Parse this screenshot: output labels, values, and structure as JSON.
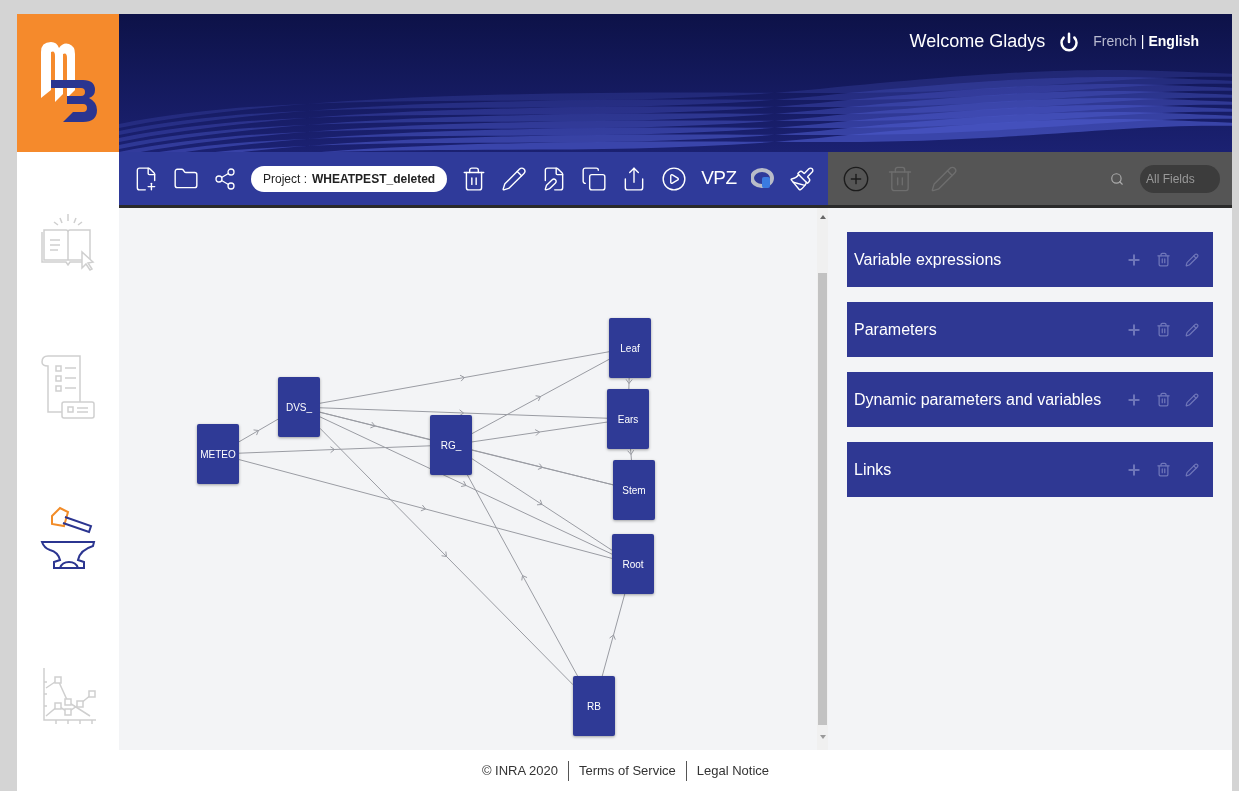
{
  "header": {
    "welcome": "Welcome Gladys",
    "languages": [
      {
        "label": "French",
        "selected": false
      },
      {
        "label": "English",
        "selected": true
      }
    ],
    "separator": "|"
  },
  "sidebar": {
    "items": [
      {
        "kind": "documentation",
        "selected": false
      },
      {
        "kind": "form",
        "selected": false
      },
      {
        "kind": "workshop",
        "selected": true
      },
      {
        "kind": "chart",
        "selected": false
      }
    ]
  },
  "toolbar": {
    "project_label": "Project :",
    "project_name": "WHEATPEST_deleted",
    "vpz": "VPZ"
  },
  "edit_actions": [
    {
      "kind": "add",
      "disabled": false
    },
    {
      "kind": "delete",
      "disabled": true
    },
    {
      "kind": "edit",
      "disabled": true
    }
  ],
  "search": {
    "placeholder": "All Fields"
  },
  "graph": {
    "nodes": [
      {
        "label": "METEO"
      },
      {
        "label": "DVS_"
      },
      {
        "label": "RG_"
      },
      {
        "label": "Leaf"
      },
      {
        "label": "Ears"
      },
      {
        "label": "Stem"
      },
      {
        "label": "Root"
      },
      {
        "label": "RB"
      }
    ]
  },
  "panel": {
    "sections": [
      {
        "title": "Variable expressions"
      },
      {
        "title": "Parameters"
      },
      {
        "title": "Dynamic parameters and variables"
      },
      {
        "title": "Links"
      }
    ]
  },
  "footer": {
    "copyright": "© INRA 2020",
    "links": [
      "Terms of Service",
      "Legal Notice"
    ]
  }
}
